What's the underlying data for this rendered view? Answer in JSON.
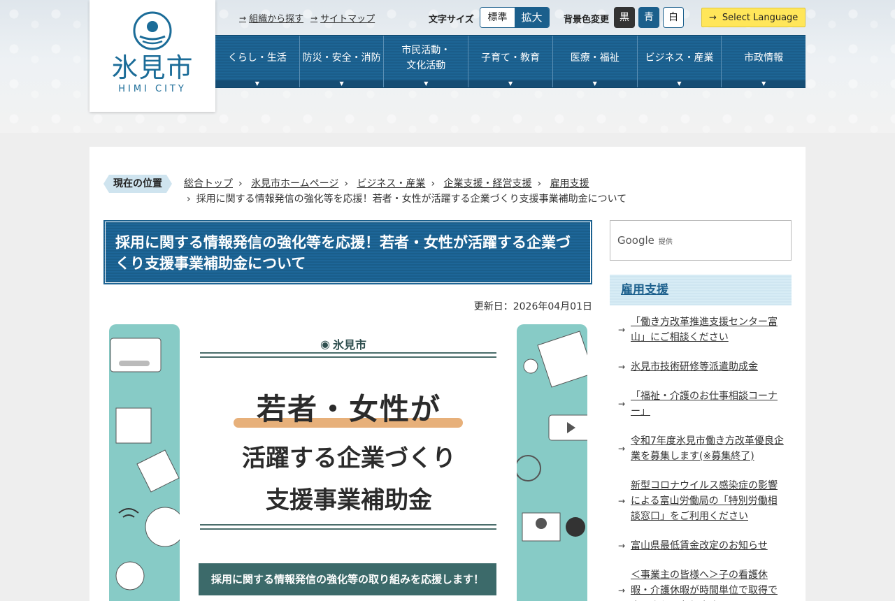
{
  "header": {
    "logo": {
      "name": "氷見市",
      "sub": "HIMI CITY"
    },
    "util_links": [
      "組織から探す",
      "サイトマップ"
    ],
    "font_size": {
      "label": "文字サイズ",
      "standard": "標準",
      "large": "拡大"
    },
    "bg_color": {
      "label": "背景色変更",
      "black": "黒",
      "blue": "青",
      "white": "白"
    },
    "language": "Select Language",
    "nav": [
      "くらし・生活",
      "防災・安全・消防",
      "市民活動・\n文化活動",
      "子育て・教育",
      "医療・福祉",
      "ビジネス・産業",
      "市政情報"
    ]
  },
  "breadcrumb": {
    "tag": "現在の位置",
    "items": [
      "総合トップ",
      "氷見市ホームページ",
      "ビジネス・産業",
      "企業支援・経営支援",
      "雇用支援"
    ],
    "current": "採用に関する情報発信の強化等を応援！若者・女性が活躍する企業づくり支援事業補助金について"
  },
  "article": {
    "title": "採用に関する情報発信の強化等を応援！若者・女性が活躍する企業づくり支援事業補助金について",
    "updated": "更新日：2026年04月01日",
    "banner": {
      "logo": "氷見市",
      "line1": "若者・女性が",
      "line2": "活躍する企業づくり",
      "line3": "支援事業補助金",
      "strip": "採用に関する情報発信の強化等の取り組みを応援します！"
    }
  },
  "sidebar": {
    "search": {
      "google": "Google",
      "provided": "提供"
    },
    "heading": "雇用支援",
    "items": [
      "「働き方改革推進支援センター富山」にご相談ください",
      "氷見市技術研修等派遣助成金",
      "「福祉・介護のお仕事相談コーナー」",
      "令和7年度氷見市働き方改革優良企業を募集します(※募集終了)",
      "新型コロナウイルス感染症の影響による富山労働局の「特別労働相談窓口」をご利用ください",
      "富山県最低賃金改定のお知らせ",
      "＜事業主の皆様へ＞子の看護休暇・介護休暇が時間単位で取得できるようになります"
    ]
  },
  "colors": {
    "primary": "#1b5f8c",
    "accent_yellow": "#ffe65a",
    "teal": "#87cbc6"
  }
}
